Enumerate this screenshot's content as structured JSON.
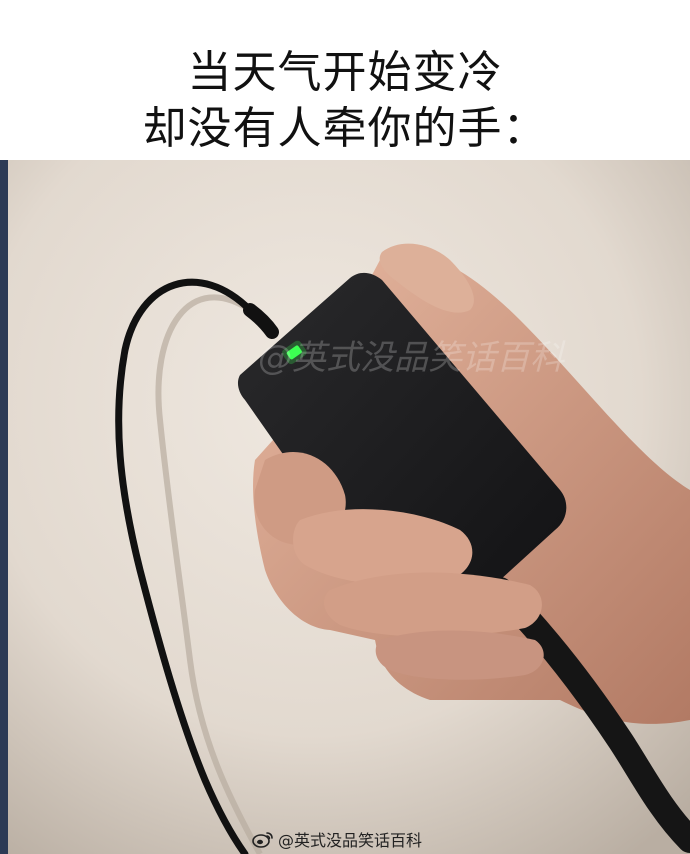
{
  "caption": {
    "line1": "当天气开始变冷",
    "line2": "却没有人牵你的手："
  },
  "watermark": {
    "center_text": "@英式没品笑话百科",
    "bottom_text": "@英式没品笑话百科",
    "logo_icon": "weibo-icon"
  },
  "colors": {
    "wall": "#e9e2da",
    "adapter": "#1c1c1e",
    "led": "#3dff52",
    "skin": "#d9a78f"
  }
}
